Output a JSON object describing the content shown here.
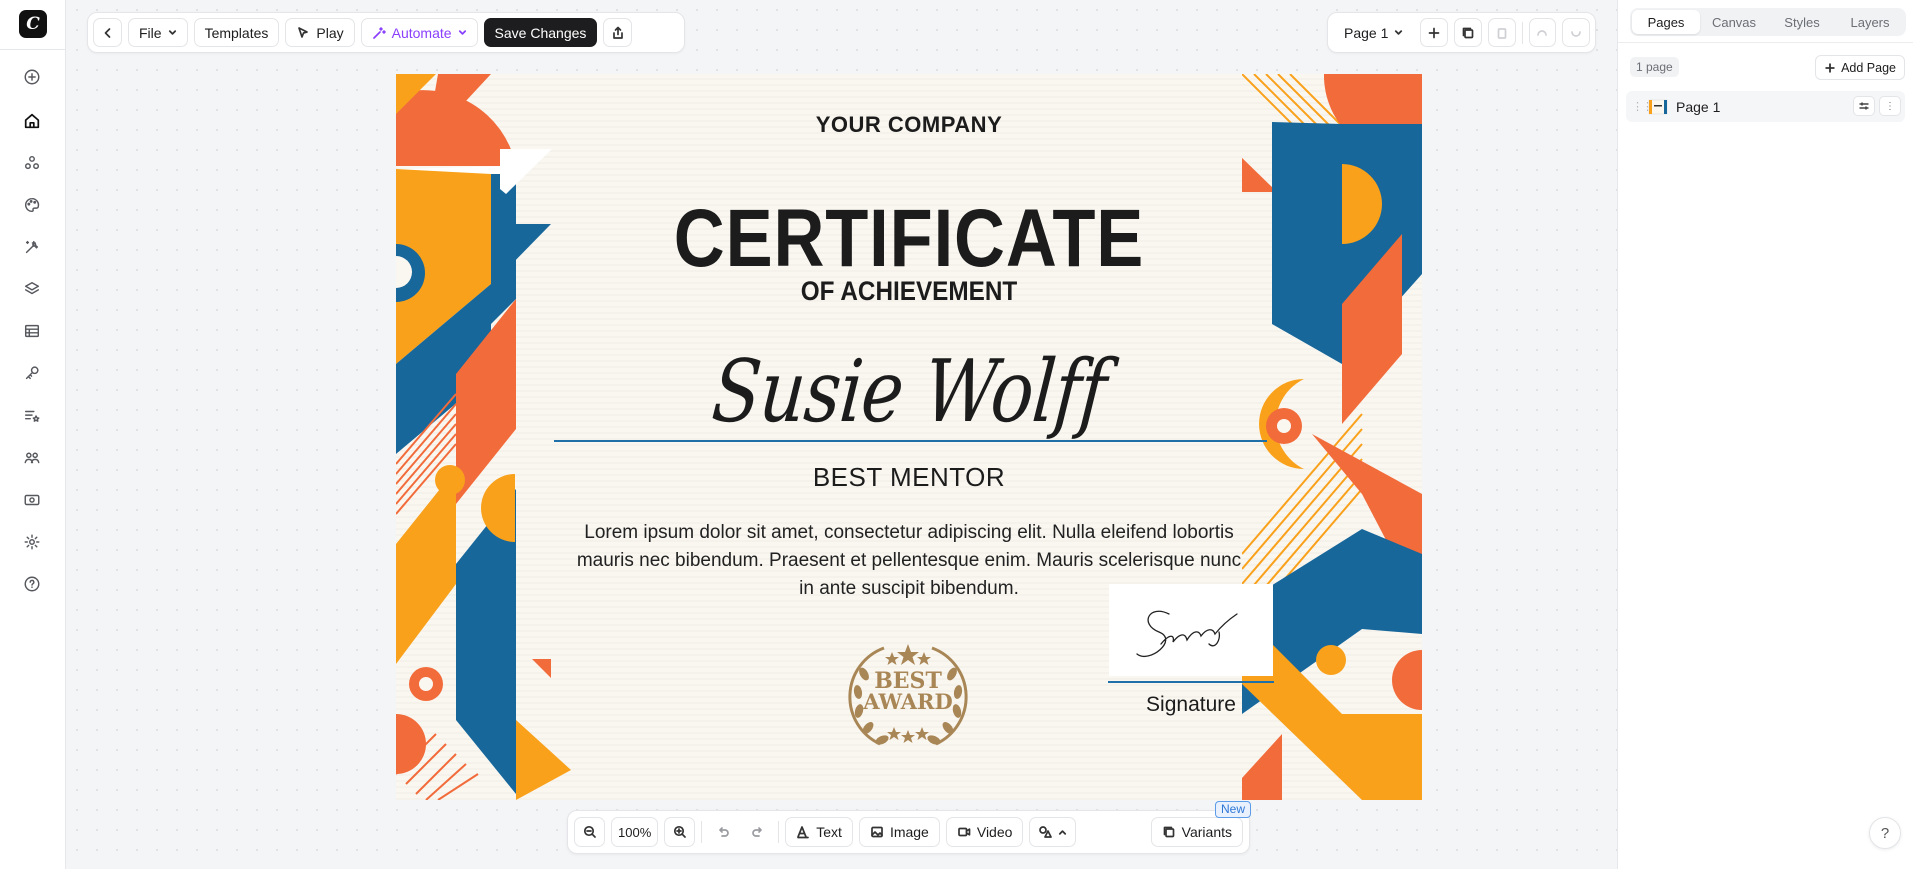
{
  "left_rail": {
    "logo": "C",
    "icons": [
      "plus-circle-icon",
      "home-icon",
      "elements-icon",
      "palette-icon",
      "magic-wand-icon",
      "layers-icon",
      "table-icon",
      "key-icon",
      "list-star-icon",
      "team-icon",
      "money-icon",
      "gear-icon",
      "help-circle-icon"
    ]
  },
  "toolbar": {
    "back_icon": "chevron-left-icon",
    "file_label": "File",
    "templates_label": "Templates",
    "play_label": "Play",
    "automate_label": "Automate",
    "save_label": "Save Changes",
    "share_icon": "share-icon",
    "page_select": "Page 1"
  },
  "certificate": {
    "company": "YOUR COMPANY",
    "title": "CERTIFICATE",
    "subtitle": "OF ACHIEVEMENT",
    "recipient": "Susie Wolff",
    "role": "BEST MENTOR",
    "body": "Lorem ipsum dolor sit amet, consectetur adipiscing elit. Nulla eleifend lobortis mauris nec bibendum. Praesent et pellentesque enim. Mauris scelerisque nunc in ante suscipit bibendum.",
    "award_line1": "BEST",
    "award_line2": "AWARD",
    "signature_label": "Signature",
    "colors": {
      "blue": "#17679b",
      "orange": "#f26b3a",
      "yellow": "#f9a11b",
      "cream": "#faf7f1",
      "gold": "#a98656"
    }
  },
  "bottom_toolbar": {
    "zoom": "100%",
    "text_label": "Text",
    "image_label": "Image",
    "video_label": "Video",
    "variants_label": "Variants",
    "new_badge": "New"
  },
  "right_panel": {
    "tabs": [
      "Pages",
      "Canvas",
      "Styles",
      "Layers"
    ],
    "active_tab": "Pages",
    "page_count": "1 page",
    "add_page_label": "Add Page",
    "pages": [
      {
        "name": "Page 1"
      }
    ]
  },
  "help_label": "?"
}
